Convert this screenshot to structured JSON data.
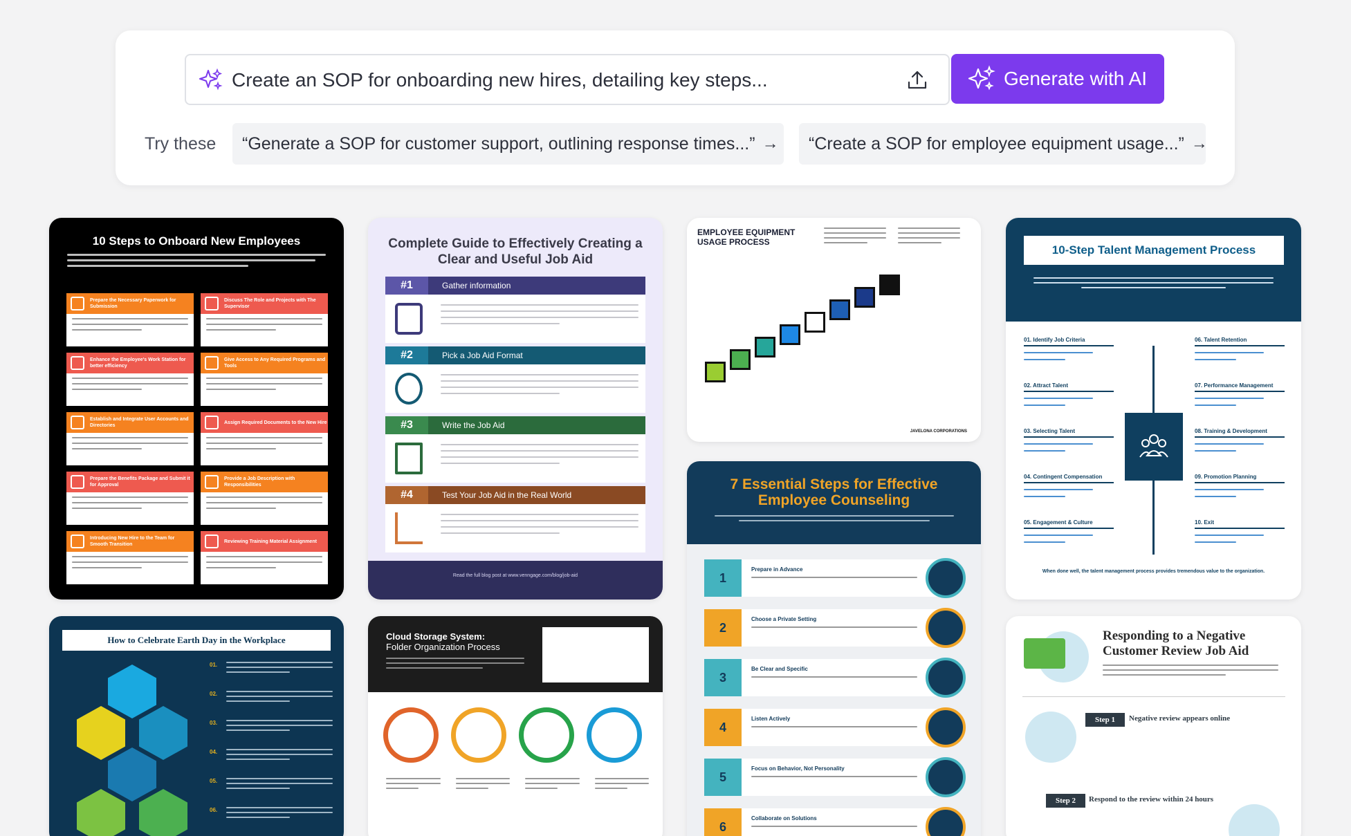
{
  "prompt": {
    "input_text": "Create an SOP for onboarding new hires, detailing key steps...",
    "generate_label": "Generate with AI",
    "try_label": "Try these",
    "suggestions": [
      "“Generate a SOP for customer support, outlining response times...”",
      "“Create a SOP for employee equipment usage...”"
    ],
    "accent_color": "#7c3aed"
  },
  "templates": [
    {
      "title": "10 Steps to Onboard New Employees",
      "steps": [
        "Prepare the Necessary Paperwork for Submission",
        "Discuss The Role and Projects with The Supervisor",
        "Enhance the Employee's Work Station for better efficiency",
        "Give Access to Any Required Programs and Tools",
        "Establish and Integrate User Accounts and Directories",
        "Assign Required Documents to the New Hire",
        "Prepare the Benefits Package and Submit it for Approval",
        "Provide a Job Description with Responsibilities",
        "Introducing New Hire to the Team for Smooth Transition",
        "Reviewing Training Material Assignment"
      ]
    },
    {
      "title": "Complete Guide to Effectively Creating a Clear and Useful Job Aid",
      "sections": [
        {
          "num": "#1",
          "label": "Gather information",
          "color": "#3d3a7a"
        },
        {
          "num": "#2",
          "label": "Pick a Job Aid Format",
          "color": "#145a73"
        },
        {
          "num": "#3",
          "label": "Write the Job Aid",
          "color": "#2b6b3c"
        },
        {
          "num": "#4",
          "label": "Test Your Job Aid in the Real World",
          "color": "#8a4a23"
        }
      ],
      "footer": "Read the full blog post at www.venngage.com/blog/job-aid"
    },
    {
      "title_line1": "EMPLOYEE EQUIPMENT",
      "title_line2": "USAGE PROCESS",
      "brand": "JAVELONA CORPORATIONS"
    },
    {
      "title": "10-Step Talent Management Process",
      "left": [
        "01. Identify Job Criteria",
        "02. Attract Talent",
        "03. Selecting Talent",
        "04. Contingent Compensation",
        "05. Engagement & Culture"
      ],
      "right": [
        "06. Talent Retention",
        "07. Performance Management",
        "08. Training & Development",
        "09. Promotion Planning",
        "10. Exit"
      ],
      "footer": "When done well, the talent management process provides tremendous value to the organization."
    },
    {
      "title": "How to Celebrate Earth Day in the Workplace",
      "nums": [
        "01.",
        "02.",
        "03.",
        "04.",
        "05.",
        "06."
      ]
    },
    {
      "title_line1": "Cloud Storage System:",
      "title_line2": "Folder Organization Process"
    },
    {
      "title": "7 Essential Steps for Effective Employee Counseling",
      "rows": [
        {
          "n": "1",
          "h": "Prepare in Advance",
          "color": "#44b3bf"
        },
        {
          "n": "2",
          "h": "Choose a Private Setting",
          "color": "#f0a427"
        },
        {
          "n": "3",
          "h": "Be Clear and Specific",
          "color": "#44b3bf"
        },
        {
          "n": "4",
          "h": "Listen Actively",
          "color": "#f0a427"
        },
        {
          "n": "5",
          "h": "Focus on Behavior, Not Personality",
          "color": "#44b3bf"
        },
        {
          "n": "6",
          "h": "Collaborate on Solutions",
          "color": "#f0a427"
        }
      ]
    },
    {
      "title": "Responding to a Negative Customer Review Job Aid",
      "step1": "Step 1",
      "step1_label": "Negative review appears online",
      "step2": "Step 2",
      "step2_label": "Respond to the review within 24 hours"
    }
  ]
}
